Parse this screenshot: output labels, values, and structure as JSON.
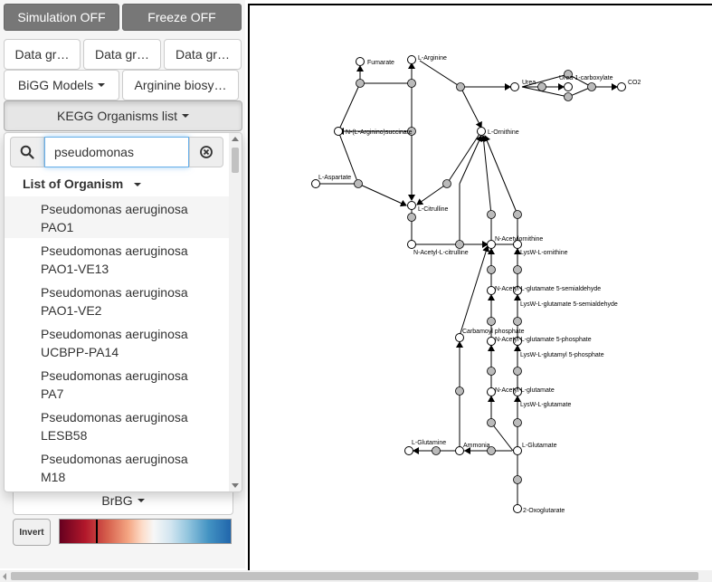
{
  "toolbar": {
    "simulation_label": "Simulation OFF",
    "freeze_label": "Freeze OFF"
  },
  "data_buttons": [
    "Data gr…",
    "Data gr…",
    "Data gr…"
  ],
  "model_menu": {
    "bigg_label": "BiGG Models",
    "map_label": "Arginine biosy…"
  },
  "kegg": {
    "button_label": "KEGG Organisms list",
    "search_value": "pseudomonas",
    "list_header": "List of Organism",
    "organisms": [
      {
        "line1": "Pseudomonas aeruginosa",
        "line2": "PAO1"
      },
      {
        "line1": "Pseudomonas aeruginosa",
        "line2": "PAO1-VE13"
      },
      {
        "line1": "Pseudomonas aeruginosa",
        "line2": "PAO1-VE2"
      },
      {
        "line1": "Pseudomonas aeruginosa",
        "line2": "UCBPP-PA14"
      },
      {
        "line1": "Pseudomonas aeruginosa",
        "line2": "PA7"
      },
      {
        "line1": "Pseudomonas aeruginosa",
        "line2": "LESB58"
      },
      {
        "line1": "Pseudomonas aeruginosa",
        "line2": "M18"
      }
    ]
  },
  "colorscale": {
    "name": "BrBG",
    "invert_label": "Invert"
  },
  "pathway": {
    "metabolites": {
      "fumarate": "Fumarate",
      "arginine": "L-Arginine",
      "urea": "Urea",
      "urea_carboxylate": "Urea-1-carboxylate",
      "co2": "CO2",
      "argininosuccinate": "N-(L-Arginino)succinate",
      "ornithine": "L-Ornithine",
      "aspartate": "L-Aspartate",
      "citrulline": "L-Citrulline",
      "acetyl_citrulline": "N-Acetyl-L-citrulline",
      "acetylornithine": "N-Acetylornithine",
      "lysw_ornithine": "LysW-L-ornithine",
      "acetyl_semialdehyde": "N-Acetyl-L-glutamate 5-semialdehyde",
      "lysw_semialdehyde": "LysW-L-glutamate 5-semialdehyde",
      "carbamoyl": "Carbamoyl phosphate",
      "acetyl_phosphate": "N-Acetyl-L-glutamate 5-phosphate",
      "lysw_phosphate": "LysW-L-glutamyl 5-phosphate",
      "acetyl_glutamate": "N-Acetyl-L-glutamate",
      "lysw_glutamate": "LysW-L-glutamate",
      "glutamine": "L-Glutamine",
      "ammonia": "Ammonia",
      "glutamate": "L-Glutamate",
      "oxoglutarate": "2-Oxoglutarate"
    }
  }
}
